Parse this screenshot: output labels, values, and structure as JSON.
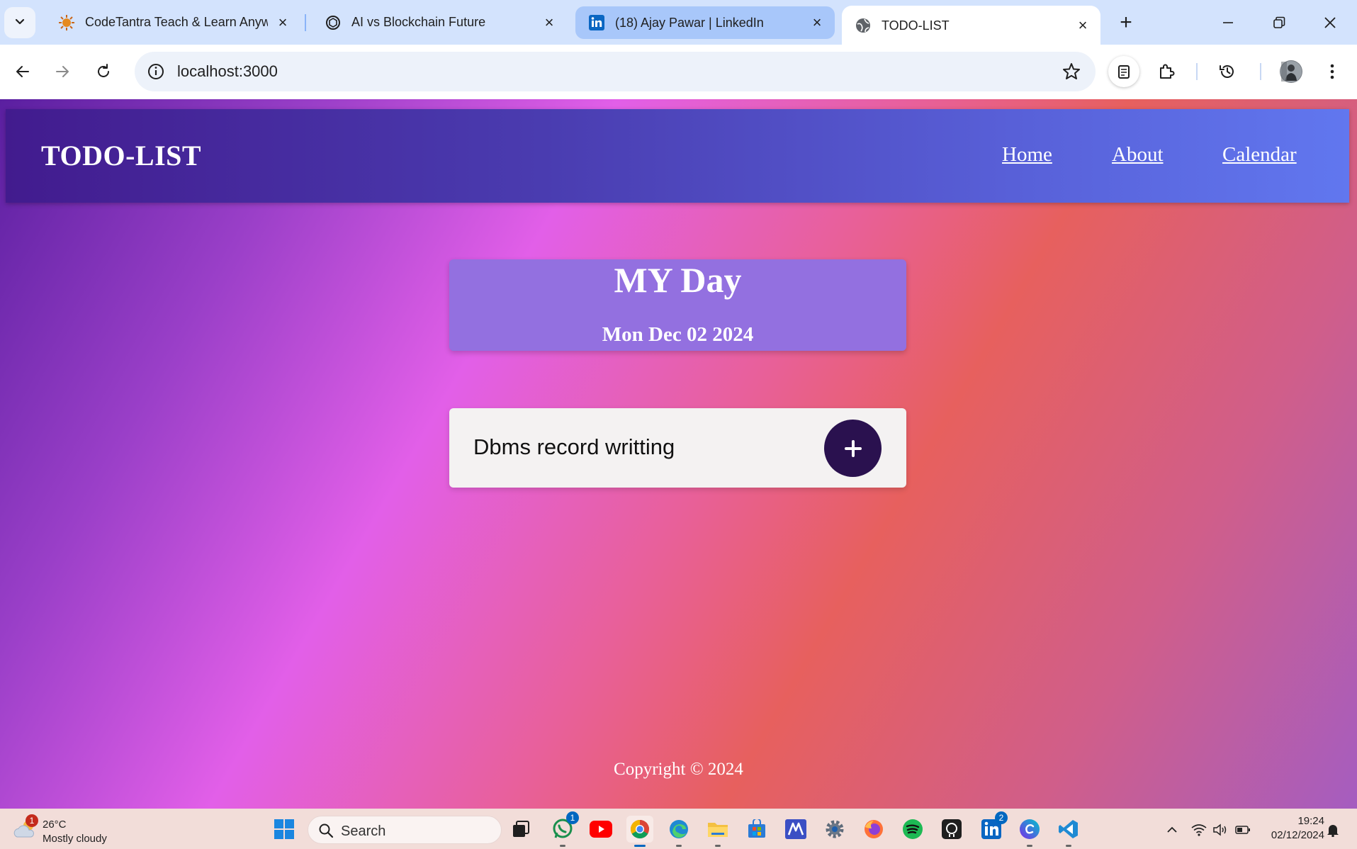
{
  "browser": {
    "tabs": [
      {
        "title": "CodeTantra Teach & Learn Anywh",
        "icon": "codetantra-icon"
      },
      {
        "title": "AI vs Blockchain Future",
        "icon": "chatgpt-icon"
      },
      {
        "title": "(18) Ajay Pawar | LinkedIn",
        "icon": "linkedin-icon"
      },
      {
        "title": "TODO-LIST",
        "icon": "globe-icon"
      }
    ],
    "active_tab": 3,
    "url": "localhost:3000"
  },
  "page": {
    "brand": "TODO-LIST",
    "nav": [
      "Home",
      "About",
      "Calendar"
    ],
    "day_title": "MY Day",
    "date": "Mon Dec 02 2024",
    "task_input_value": "Dbms record writting",
    "add_button_label": "+",
    "footer": "Copyright © 2024"
  },
  "taskbar": {
    "weather": {
      "temp": "26°C",
      "condition": "Mostly cloudy",
      "badge": "1"
    },
    "search_label": "Search",
    "apps": [
      {
        "name": "start-icon"
      },
      {
        "name": "task-view-icon"
      },
      {
        "name": "whatsapp-icon",
        "badge": "1"
      },
      {
        "name": "youtube-icon"
      },
      {
        "name": "chrome-icon"
      },
      {
        "name": "edge-icon"
      },
      {
        "name": "file-explorer-icon"
      },
      {
        "name": "microsoft-store-icon"
      },
      {
        "name": "math-app-icon"
      },
      {
        "name": "settings-icon"
      },
      {
        "name": "firefox-icon"
      },
      {
        "name": "spotify-icon"
      },
      {
        "name": "github-icon"
      },
      {
        "name": "linkedin-icon",
        "badge": "2"
      },
      {
        "name": "canva-icon"
      },
      {
        "name": "vscode-icon"
      }
    ],
    "time": "19:24",
    "date": "02/12/2024"
  },
  "colors": {
    "navbar_start": "#421b8e",
    "navbar_end": "#6177ef",
    "day_card": "#9370e0",
    "add_button": "#2a114f",
    "task_card": "#f4f2f2"
  }
}
